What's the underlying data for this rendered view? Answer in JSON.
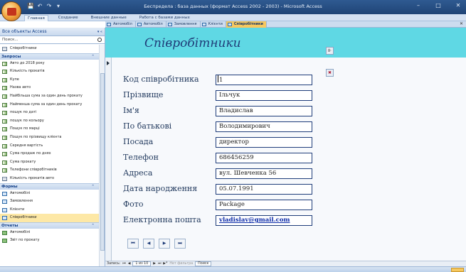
{
  "window": {
    "title": "Беспредела : база данных (формат Access 2002 - 2003) - Microsoft Access",
    "controls": [
      "–",
      "□",
      "✕"
    ],
    "quick_access": [
      "💾",
      "↶",
      "↷",
      "▾"
    ]
  },
  "ribbon": {
    "tabs": [
      "Главная",
      "Создание",
      "Внешние данные",
      "Работа с базами данных"
    ]
  },
  "nav": {
    "header": "Все объекты Access",
    "header_controls": "▾ «",
    "search_placeholder": "Поиск...",
    "top_items": [
      {
        "label": "Співробітники",
        "icon": "table-icon"
      }
    ],
    "groups": [
      {
        "name": "Запросы",
        "chevron": "⌃",
        "items": [
          {
            "label": "Авто до 2018 року",
            "icon": "query-icon"
          },
          {
            "label": "Кількість прокатів",
            "icon": "query-icon"
          },
          {
            "label": "Купе",
            "icon": "query-icon"
          },
          {
            "label": "Назва авто",
            "icon": "query-icon"
          },
          {
            "label": "Найбільша сума за один день прокату",
            "icon": "query-icon"
          },
          {
            "label": "Найменша сума за один день прокату",
            "icon": "query-icon"
          },
          {
            "label": "пошук по даті",
            "icon": "query-icon"
          },
          {
            "label": "пошук по кольору",
            "icon": "query-icon"
          },
          {
            "label": "Пошук по марці",
            "icon": "query-icon"
          },
          {
            "label": "Пошук по прізвищу клієнта",
            "icon": "query-icon"
          },
          {
            "label": "Середня вартість",
            "icon": "query-icon"
          },
          {
            "label": "Сума продаж по днях",
            "icon": "query-icon"
          },
          {
            "label": "Сума прокату",
            "icon": "query-icon"
          },
          {
            "label": "Телефони співробітників",
            "icon": "query-icon"
          },
          {
            "label": "Кількість прокатів авто",
            "icon": "table-icon"
          }
        ]
      },
      {
        "name": "Формы",
        "chevron": "⌃",
        "items": [
          {
            "label": "Автомобілі",
            "icon": "form-icon"
          },
          {
            "label": "Замовлення",
            "icon": "form-icon"
          },
          {
            "label": "Клієнти",
            "icon": "form-icon"
          },
          {
            "label": "Співробітники",
            "icon": "form-icon",
            "selected": true
          }
        ]
      },
      {
        "name": "Отчеты",
        "chevron": "⌃",
        "items": [
          {
            "label": "Автомобілі",
            "icon": "report-icon"
          },
          {
            "label": "Звіт по прокату",
            "icon": "report-icon"
          }
        ]
      }
    ]
  },
  "doc_tabs": [
    {
      "label": "Автомобіл",
      "active": false
    },
    {
      "label": "Автомобіл",
      "active": false
    },
    {
      "label": "Замовлення",
      "active": false
    },
    {
      "label": "Клієнти",
      "active": false
    },
    {
      "label": "Співробітники",
      "active": true
    }
  ],
  "doc_close": "✕",
  "form": {
    "title": "Співробітники",
    "fields": [
      {
        "label": "Код співробітника",
        "value": "1"
      },
      {
        "label": "Прізвище",
        "value": "Ільчук"
      },
      {
        "label": "Ім'я",
        "value": "Владислав"
      },
      {
        "label": "По батькові",
        "value": "Володимирович"
      },
      {
        "label": "Посада",
        "value": "директор"
      },
      {
        "label": "Телефон",
        "value": "686456259"
      },
      {
        "label": "Адреса",
        "value": "вул. Шевченка 56"
      },
      {
        "label": "Дата народження",
        "value": "05.07.1991"
      },
      {
        "label": "Фото",
        "value": "Package"
      },
      {
        "label": "Електронна пошта",
        "value": "vladislav@gmail.com"
      }
    ],
    "close_button": "⊪",
    "delete_button": "✖",
    "nav_buttons": [
      "⏮",
      "◀",
      "▶",
      "⏭"
    ]
  },
  "record_bar": {
    "prefix": "Запись:",
    "first": "⏮",
    "prev": "◀",
    "position": "1 из 10",
    "next": "▶",
    "last": "⏭",
    "new": "▶*",
    "filter": "Нет фильтра",
    "search": "Поиск"
  }
}
